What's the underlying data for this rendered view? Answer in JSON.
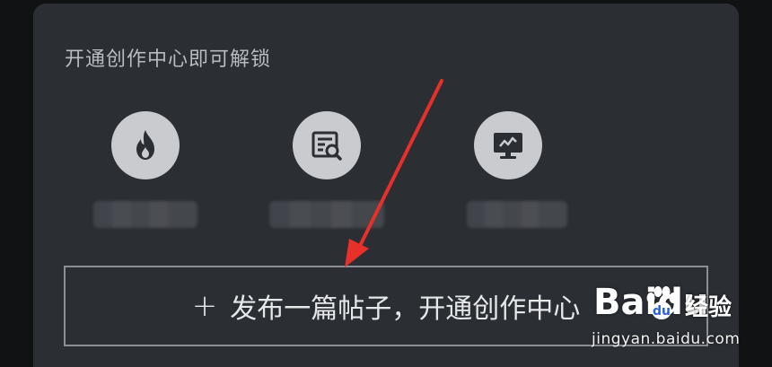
{
  "unlock_section": {
    "title": "开通创作中心即可解锁"
  },
  "features": [
    {
      "icon": "flame-icon"
    },
    {
      "icon": "search-document-icon"
    },
    {
      "icon": "monitor-chart-icon"
    }
  ],
  "publish": {
    "plus_label": "+",
    "label": "发布一篇帖子，开通创作中心"
  },
  "watermark": {
    "brand": "Baidu",
    "sub": "经验",
    "url": "jingyan.baidu.com"
  },
  "colors": {
    "panel_bg": "#2b2e33",
    "icon_circle": "#c9cbcf",
    "icon_glyph": "#2b2e33",
    "annotation_arrow": "#e8302a"
  }
}
